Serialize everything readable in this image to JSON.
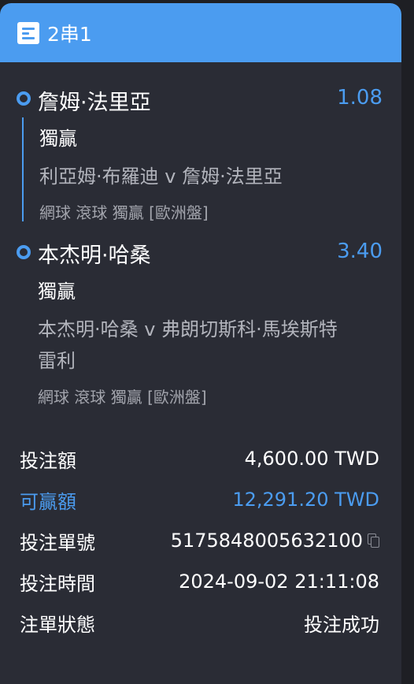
{
  "header": {
    "title": "2串1",
    "icon": "ticket-icon"
  },
  "legs": [
    {
      "player": "詹姆·法里亞",
      "odds": "1.08",
      "market": "獨贏",
      "match": "利亞姆·布羅迪 v 詹姆·法里亞",
      "meta": "網球 滾球   獨贏 [歐洲盤]"
    },
    {
      "player": "本杰明·哈桑",
      "odds": "3.40",
      "market": "獨贏",
      "match_line1": "本杰明·哈桑 v 弗朗切斯科·馬埃斯特",
      "match_line2": "雷利",
      "meta": "網球 滾球   獨贏 [歐洲盤]"
    }
  ],
  "summary": {
    "stake_label": "投注額",
    "stake_value": "4,600.00 TWD",
    "win_label": "可贏額",
    "win_value": "12,291.20 TWD",
    "ticket_label": "投注單號",
    "ticket_value": "5175848005632100",
    "time_label": "投注時間",
    "time_value": "2024-09-02 21:11:08",
    "status_label": "注單狀態",
    "status_value": "投注成功"
  },
  "colors": {
    "accent": "#4b9cf0",
    "background": "#1e1f24",
    "card": "#2a2c35"
  }
}
